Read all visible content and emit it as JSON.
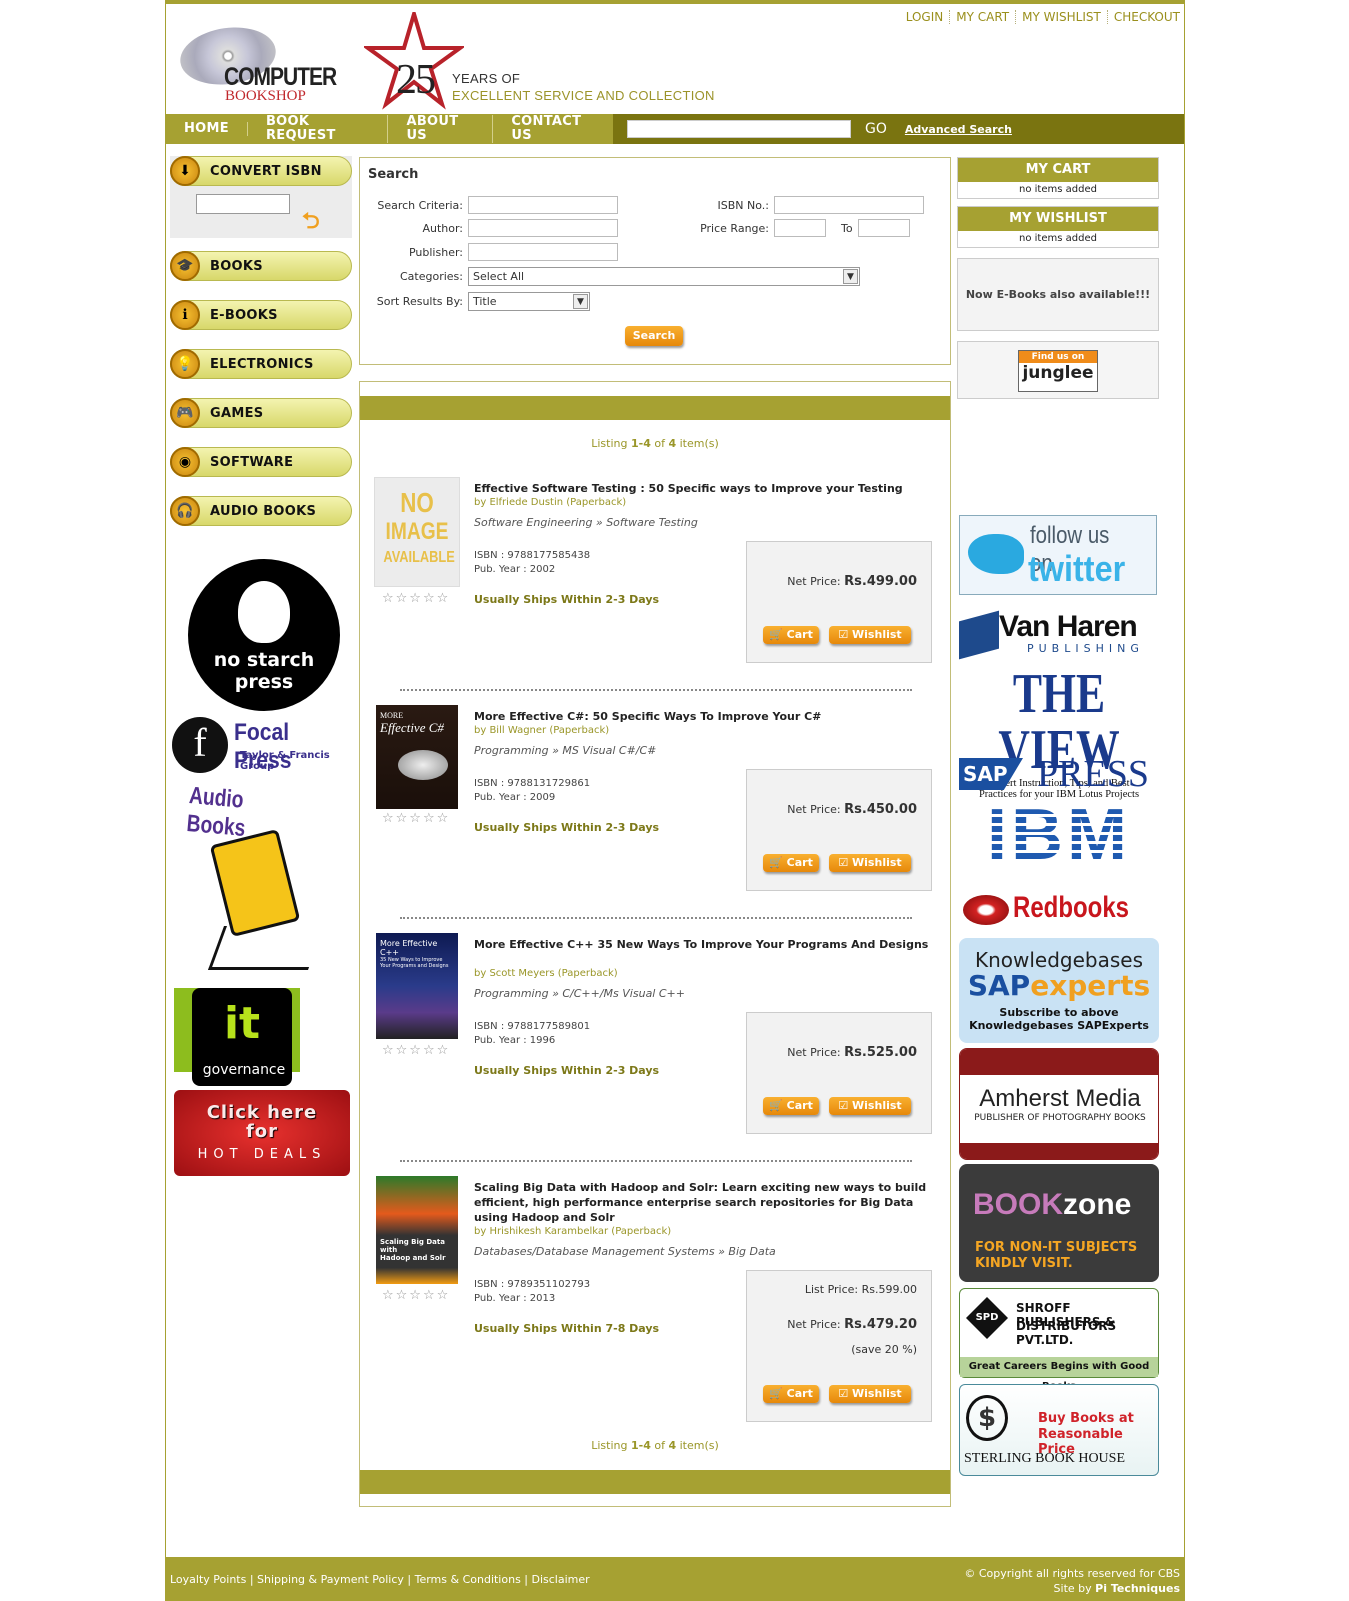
{
  "header": {
    "toplinks": [
      "LOGIN",
      "MY CART",
      "MY WISHLIST",
      "CHECKOUT"
    ],
    "logo_line1": "COMPUTER",
    "logo_line2": "BOOKSHOP",
    "anniv_number": "25",
    "tagline_1": "YEARS OF",
    "tagline_2": "EXCELLENT SERVICE AND COLLECTION"
  },
  "nav": {
    "items": [
      "HOME",
      "BOOK REQUEST",
      "ABOUT US",
      "CONTACT US"
    ],
    "search_value": "",
    "go_label": "GO",
    "advanced_label": "Advanced Search"
  },
  "left": {
    "convert_label": "CONVERT ISBN",
    "isbn_value": "",
    "categories": [
      "BOOKS",
      "E-BOOKS",
      "ELECTRONICS",
      "GAMES",
      "SOFTWARE",
      "AUDIO BOOKS"
    ],
    "promo_nostarch_1": "no starch",
    "promo_nostarch_2": "press",
    "promo_focal_1": "Focal Press",
    "promo_focal_2": "Taylor & Francis Group",
    "promo_audio": "Audio Books",
    "promo_it": "governance",
    "promo_hot_1": "Click here",
    "promo_hot_2": "for",
    "promo_hot_3": "HOT DEALS"
  },
  "search": {
    "heading": "Search",
    "criteria_label": "Search Criteria:",
    "isbn_label": "ISBN No.:",
    "author_label": "Author:",
    "price_label": "Price Range:",
    "to_label": "To",
    "publisher_label": "Publisher:",
    "categories_label": "Categories:",
    "categories_value": "Select All",
    "sort_label": "Sort Results By:",
    "sort_value": "Title",
    "button": "Search"
  },
  "results": {
    "listing_prefix": "Listing",
    "listing_range": "1-4",
    "listing_of": "of",
    "listing_total": "4",
    "listing_suffix": "item(s)",
    "no_image_1": "NO",
    "no_image_2": "IMAGE",
    "no_image_3": "AVAILABLE",
    "cart_label": "Cart",
    "wishlist_label": "Wishlist",
    "net_price_label": "Net Price:",
    "list_price_label": "List Price:",
    "items": [
      {
        "title": "Effective Software Testing : 50 Specific ways to Improve your Testing",
        "by": "by Elfriede Dustin (Paperback)",
        "category": "Software Engineering » Software Testing",
        "isbn": "ISBN : 9788177585438",
        "year": "Pub. Year : 2002",
        "ships": "Usually Ships Within 2-3 Days",
        "net_price": "Rs.499.00",
        "cover_line1": "",
        "cover_line2": ""
      },
      {
        "title": "More Effective C#: 50 Specific Ways To Improve Your C#",
        "by": "by Bill Wagner (Paperback)",
        "category": "Programming » MS Visual C#/C#",
        "isbn": "ISBN : 9788131729861",
        "year": "Pub. Year : 2009",
        "ships": "Usually Ships Within 2-3 Days",
        "net_price": "Rs.450.00",
        "cover_line1": "MORE",
        "cover_line2": "Effective C#"
      },
      {
        "title": "More Effective C++ 35 New Ways To Improve Your Programs And Designs",
        "by": "by Scott Meyers (Paperback)",
        "category": "Programming » C/C++/Ms Visual C++",
        "isbn": "ISBN : 9788177589801",
        "year": "Pub. Year : 1996",
        "ships": "Usually Ships Within 2-3 Days",
        "net_price": "Rs.525.00",
        "cover_line1": "More Effective C++",
        "cover_line2": "35 New Ways to Improve Your Programs and Designs"
      },
      {
        "title": "Scaling Big Data with Hadoop and Solr: Learn exciting new ways to build efficient, high performance enterprise search repositories for Big Data using Hadoop and Solr",
        "by": "by Hrishikesh Karambelkar (Paperback)",
        "category": "Databases/Database Management Systems » Big Data",
        "isbn": "ISBN : 9789351102793",
        "year": "Pub. Year : 2013",
        "ships": "Usually Ships Within 7-8 Days",
        "list_price": "Rs.599.00",
        "net_price": "Rs.479.20",
        "save": "(save 20 %)",
        "cover_line1": "Scaling Big Data with",
        "cover_line2": "Hadoop and Solr"
      }
    ]
  },
  "right": {
    "cart_title": "MY CART",
    "cart_sub": "no items added",
    "wish_title": "MY WISHLIST",
    "wish_sub": "no items added",
    "ebooks_text": "Now E-Books also available!!!",
    "junglee_1": "Find us on",
    "junglee_2": "junglee",
    "twitter_1": "follow us on",
    "twitter_2": "twitter",
    "vanharen_1": "Van Haren",
    "vanharen_2": "PUBLISHING",
    "theview_1": "THE VIEW",
    "theview_2": "Expert Instruction, Tips, and Best",
    "theview_3": "Practices for your IBM Lotus Projects",
    "sap_1": "SAP",
    "sap_2": "PRESS",
    "ibm": "IBM",
    "redbooks": "Redbooks",
    "kb_1": "Knowledgebases",
    "kb_2a": "SAP",
    "kb_2b": "experts",
    "kb_3": "Subscribe to above Knowledgebases SAPExperts",
    "amherst_1": "Amherst Media",
    "amherst_2": "PUBLISHER OF PHOTOGRAPHY BOOKS",
    "bookzone_1": "BOOK",
    "bookzone_2": "zone",
    "bookzone_3": "FOR NON-IT SUBJECTS",
    "bookzone_4": "KINDLY VISIT.",
    "shroff_1": "SHROFF PUBLISHERS &",
    "shroff_2": "DISTRIBUTORS PVT.LTD.",
    "shroff_3": "Great Careers Begins with Good Books",
    "sterling_1": "Buy Books at",
    "sterling_2": "Reasonable Price",
    "sterling_3": "STERLING BOOK HOUSE"
  },
  "footer": {
    "links": [
      "Loyalty Points",
      "Shipping & Payment Policy",
      "Terms & Conditions",
      "Disclaimer"
    ],
    "copyright": "© Copyright all rights reserved for CBS",
    "site_by": "Site by",
    "site_by_name": "Pi Techniques"
  },
  "colors": {
    "olive": "#a6a132",
    "dark_olive": "#7a7410",
    "orange": "#f0a020"
  }
}
